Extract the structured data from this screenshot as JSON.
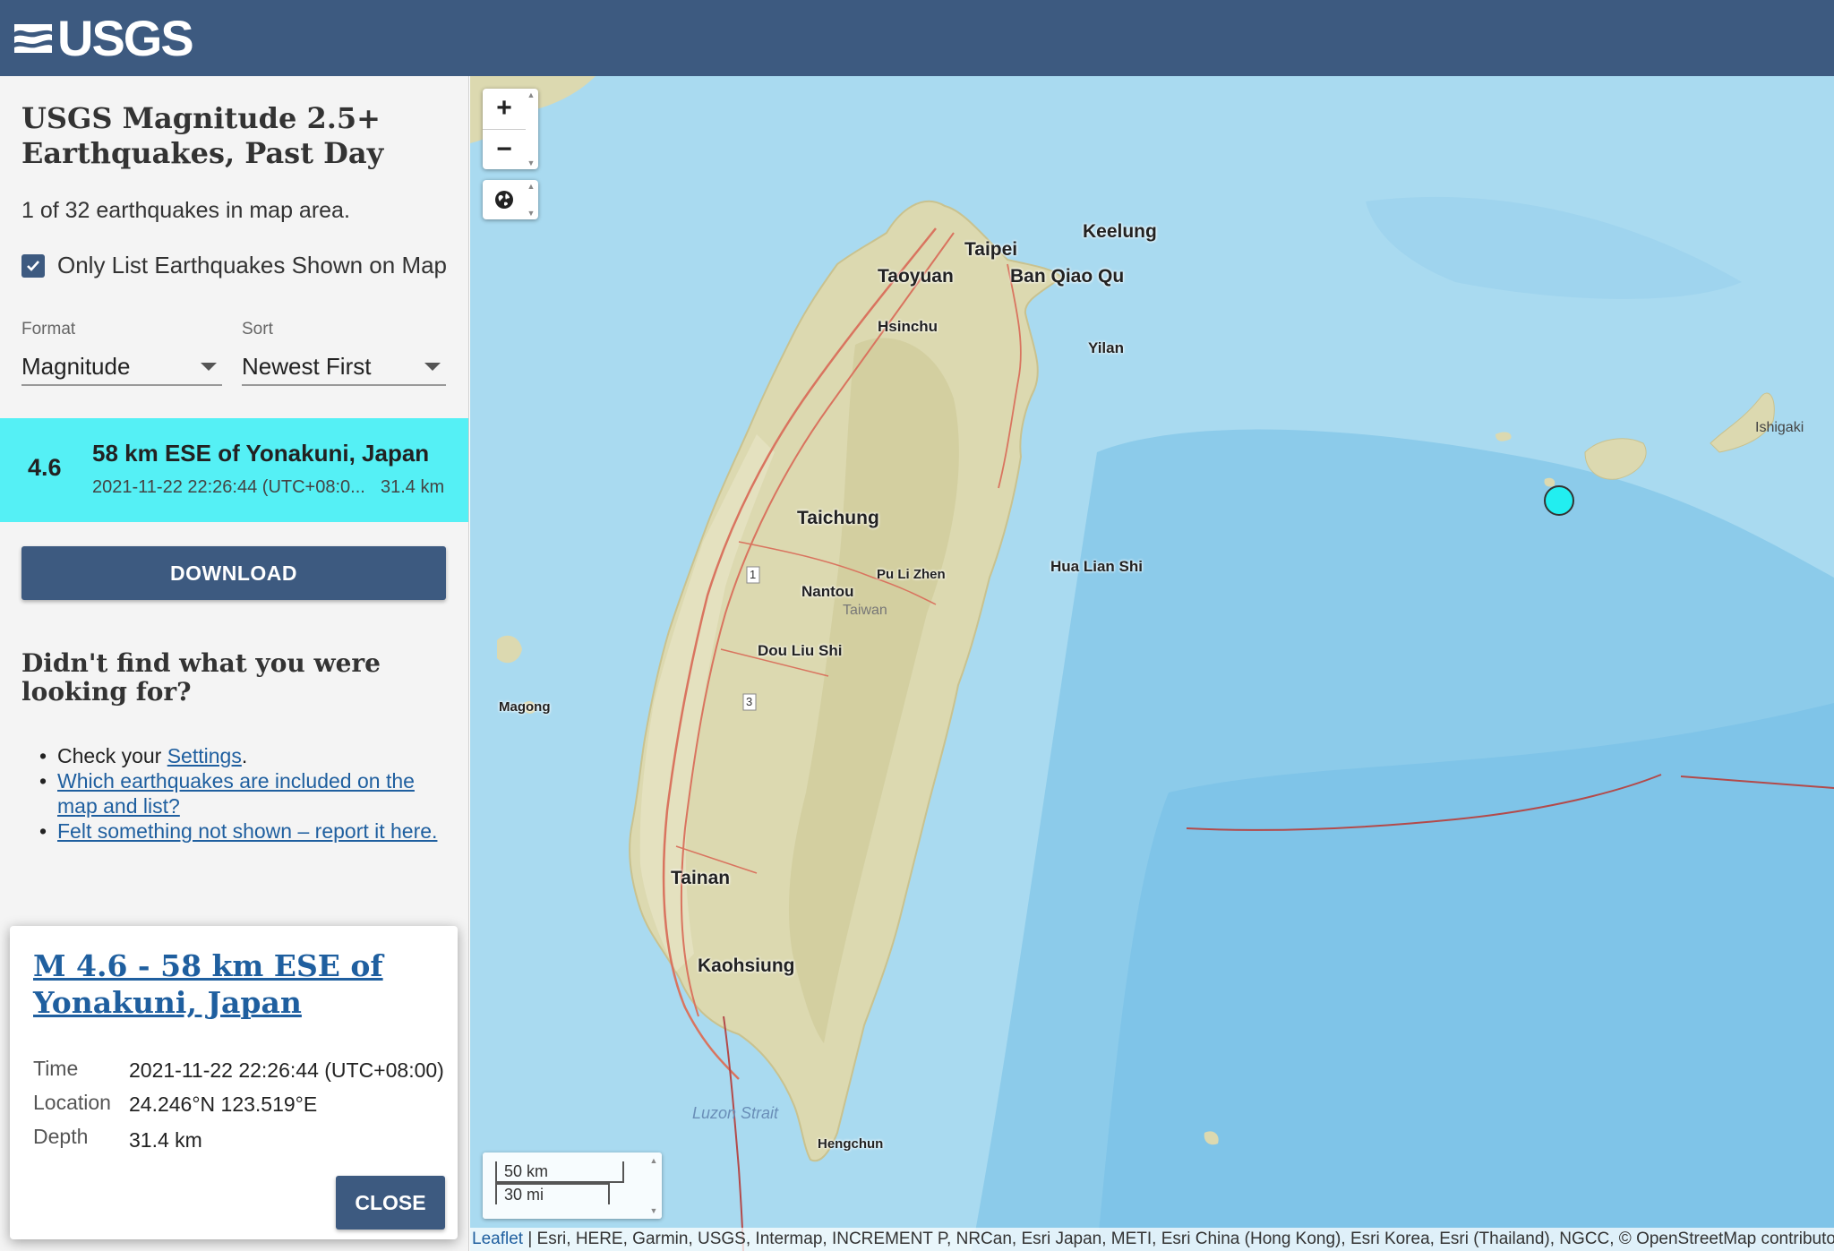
{
  "header": {
    "logo_text": "USGS"
  },
  "sidebar": {
    "title": "USGS Magnitude 2.5+ Earthquakes, Past Day",
    "count_text": "1 of 32 earthquakes in map area.",
    "checkbox_label": "Only List Earthquakes Shown on Map",
    "checkbox_checked": true,
    "format": {
      "label": "Format",
      "value": "Magnitude"
    },
    "sort": {
      "label": "Sort",
      "value": "Newest First"
    },
    "earthquake": {
      "magnitude": "4.6",
      "place": "58 km ESE of Yonakuni, Japan",
      "time": "2021-11-22 22:26:44 (UTC+08:0...",
      "depth": "31.4 km"
    },
    "download_label": "DOWNLOAD",
    "help": {
      "title": "Didn't find what you were looking for?",
      "item1_prefix": "Check your ",
      "item1_link": "Settings",
      "item1_suffix": ".",
      "item2_link": "Which earthquakes are included on the map and list?",
      "item3_link": "Felt something not shown – report it here."
    }
  },
  "popup": {
    "title": "M 4.6 - 58 km ESE of Yonakuni, Japan",
    "time_label": "Time",
    "time_value": "2021-11-22 22:26:44 (UTC+08:00)",
    "location_label": "Location",
    "location_value": "24.246°N 123.519°E",
    "depth_label": "Depth",
    "depth_value": "31.4 km",
    "close_label": "CLOSE"
  },
  "map": {
    "zoom_in": "+",
    "zoom_out": "−",
    "scale_km": "50 km",
    "scale_mi": "30 mi",
    "attribution_link": "Leaflet",
    "attribution_text": " | Esri, HERE, Garmin, USGS, Intermap, INCREMENT P, NRCan, Esri Japan, METI, Esri China (Hong Kong), Esri Korea, Esri (Thailand), NGCC, © OpenStreetMap contributors",
    "labels": {
      "keelung": "Keelung",
      "taipei": "Taipei",
      "taoyuan": "Taoyuan",
      "banqiao": "Ban Qiao Qu",
      "hsinchu": "Hsinchu",
      "yilan": "Yilan",
      "ishigaki": "Ishigaki",
      "taichung": "Taichung",
      "hualien": "Hua Lian Shi",
      "pulizhen": "Pu Li Zhen",
      "nantou": "Nantou",
      "taiwan": "Taiwan",
      "douliushi": "Dou Liu Shi",
      "magong": "Magong",
      "tainan": "Tainan",
      "kaohsiung": "Kaohsiung",
      "luzon_strait": "Luzon Strait",
      "hengchun": "Hengchun",
      "route1": "1",
      "route3": "3"
    }
  },
  "colors": {
    "header": "#3d5a80",
    "highlight_row": "#55f0f5",
    "marker": "#22eef0",
    "link": "#1f5f9f",
    "ocean": "#a9daf0",
    "land": "#dcd9b0"
  }
}
